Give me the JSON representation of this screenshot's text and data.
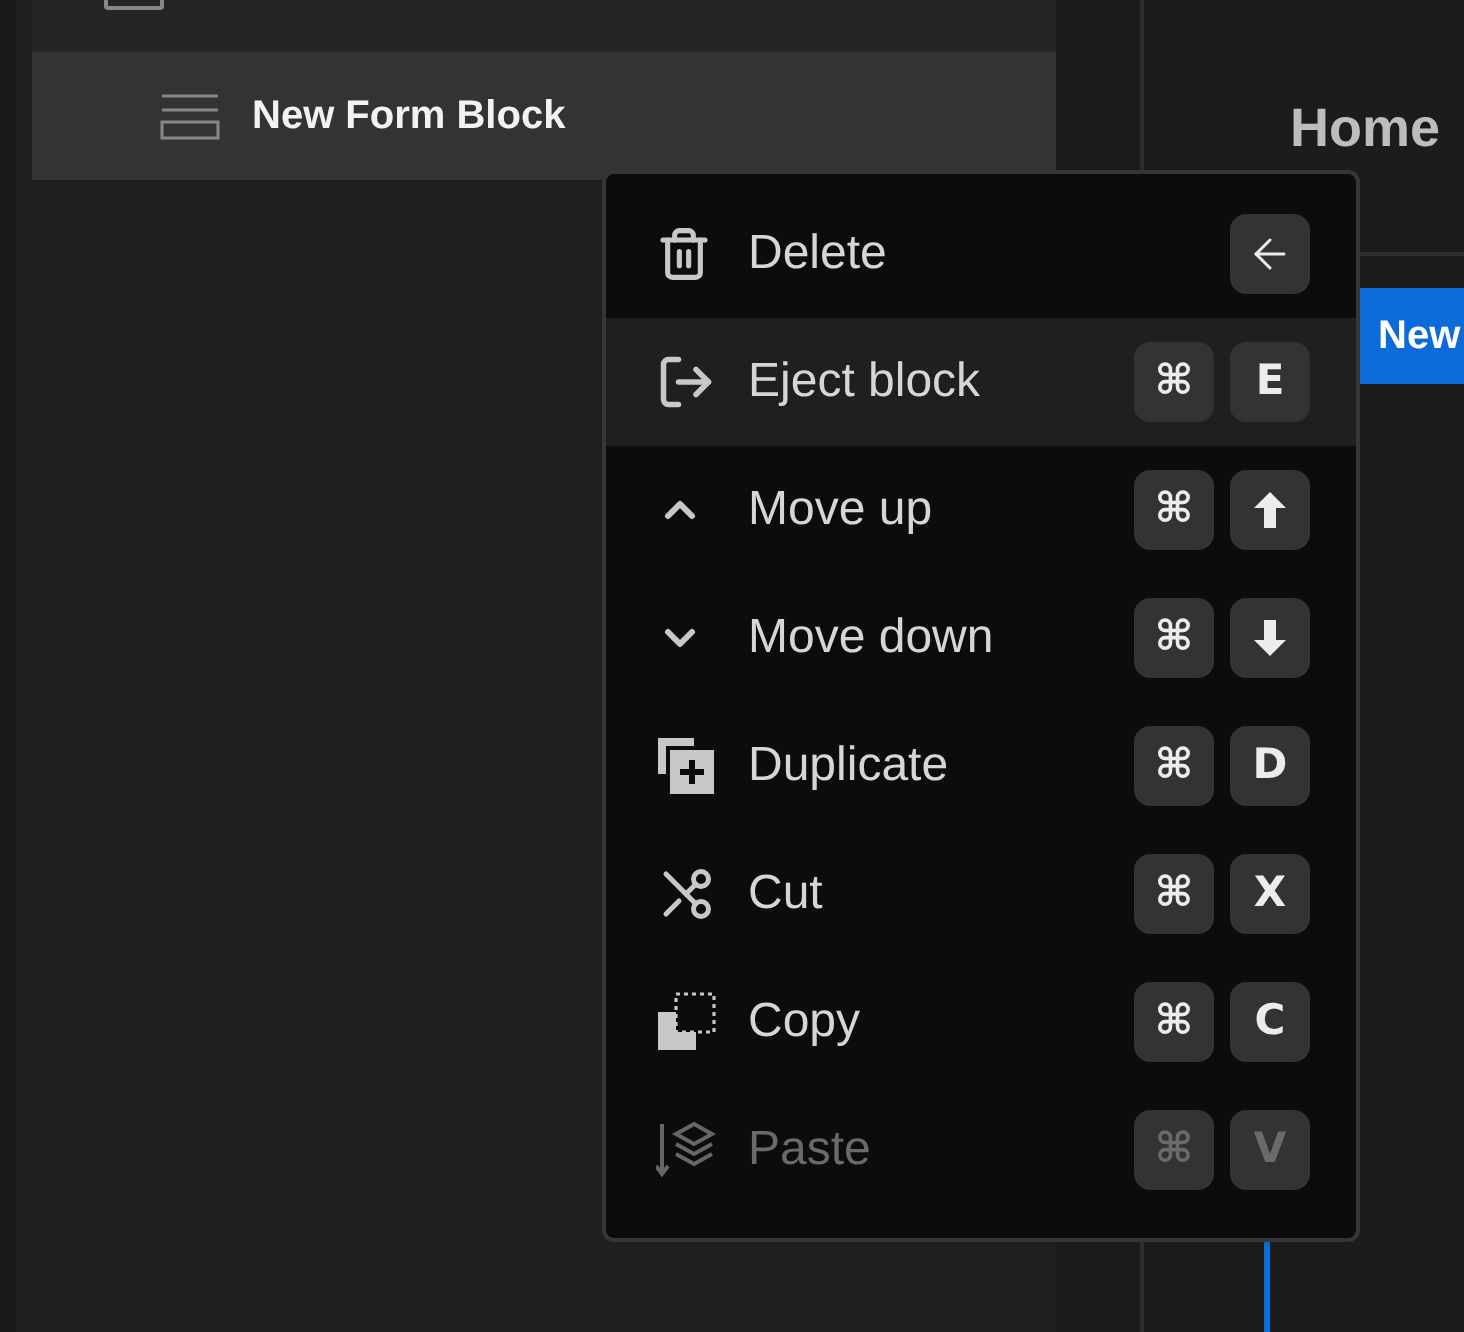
{
  "tree": [
    {
      "kind": "screen",
      "selected": false
    },
    {
      "kind": "form",
      "label": "New Form Block",
      "selected": true
    }
  ],
  "canvas": {
    "title": "Home",
    "button": "New"
  },
  "context_menu": {
    "items": [
      {
        "kind": "trash",
        "label": "Delete",
        "selected": false,
        "disabled": false,
        "keys": [
          {
            "kind": "arrow-left"
          }
        ]
      },
      {
        "kind": "eject",
        "label": "Eject block",
        "selected": true,
        "disabled": false,
        "keys": [
          {
            "kind": "text",
            "label": "⌘"
          },
          {
            "kind": "text",
            "label": "E"
          }
        ]
      },
      {
        "kind": "chevron-up",
        "label": "Move up",
        "selected": false,
        "disabled": false,
        "keys": [
          {
            "kind": "text",
            "label": "⌘"
          },
          {
            "kind": "arrow-up"
          }
        ]
      },
      {
        "kind": "chevron-down",
        "label": "Move down",
        "selected": false,
        "disabled": false,
        "keys": [
          {
            "kind": "text",
            "label": "⌘"
          },
          {
            "kind": "arrow-down"
          }
        ]
      },
      {
        "kind": "duplicate",
        "label": "Duplicate",
        "selected": false,
        "disabled": false,
        "keys": [
          {
            "kind": "text",
            "label": "⌘"
          },
          {
            "kind": "text",
            "label": "D"
          }
        ]
      },
      {
        "kind": "scissors",
        "label": "Cut",
        "selected": false,
        "disabled": false,
        "keys": [
          {
            "kind": "text",
            "label": "⌘"
          },
          {
            "kind": "text",
            "label": "X"
          }
        ]
      },
      {
        "kind": "copy",
        "label": "Copy",
        "selected": false,
        "disabled": false,
        "keys": [
          {
            "kind": "text",
            "label": "⌘"
          },
          {
            "kind": "text",
            "label": "C"
          }
        ]
      },
      {
        "kind": "paste",
        "label": "Paste",
        "selected": false,
        "disabled": true,
        "keys": [
          {
            "kind": "text",
            "label": "⌘"
          },
          {
            "kind": "text",
            "label": "V"
          }
        ]
      }
    ]
  }
}
